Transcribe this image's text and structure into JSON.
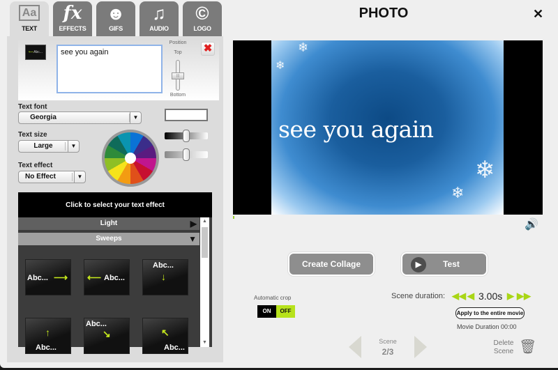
{
  "tabs": [
    {
      "label": "TEXT",
      "icon": "Aa",
      "active": true
    },
    {
      "label": "EFFECTS",
      "icon": "fx",
      "active": false
    },
    {
      "label": "GIFS",
      "icon": "☻",
      "active": false
    },
    {
      "label": "AUDIO",
      "icon": "♫",
      "active": false
    },
    {
      "label": "LOGO",
      "icon": "©",
      "active": false
    }
  ],
  "text_editor": {
    "thumb_label": "Abc...",
    "text_value": "see you again",
    "position_label": "Position",
    "position_top": "Top",
    "position_bottom": "Bottom",
    "delete_icon": "✖"
  },
  "text_font": {
    "label": "Text font",
    "value": "Georgia"
  },
  "text_size": {
    "label": "Text size",
    "value": "Large"
  },
  "text_effect": {
    "label": "Text effect",
    "value": "No Effect"
  },
  "color": {
    "swatch": "#ffffff",
    "brightness": 0.5,
    "opacity": 0.5
  },
  "effects": {
    "header": "Click to select your text effect",
    "categories": [
      {
        "label": "Light",
        "expanded": false
      },
      {
        "label": "Sweeps",
        "expanded": true
      }
    ],
    "tiles": [
      {
        "text": "Abc...",
        "arrow": "⟶"
      },
      {
        "text": "Abc...",
        "arrow": "⟵"
      },
      {
        "text": "Abc...",
        "arrow": "↓"
      },
      {
        "text": "Abc...",
        "arrow": "↑"
      },
      {
        "text": "Abc...",
        "arrow": "↘"
      },
      {
        "text": "Abc...",
        "arrow": "↖"
      }
    ]
  },
  "header": {
    "title": "PHOTO",
    "close": "✕"
  },
  "preview": {
    "slide_text": "see you again"
  },
  "buttons": {
    "create_collage": "Create Collage",
    "test": "Test"
  },
  "auto_crop": {
    "label": "Automatic crop",
    "on": "ON",
    "off": "OFF"
  },
  "duration": {
    "label": "Scene duration:",
    "value": "3.00s",
    "apply": "Apply to the entire movie",
    "movie_duration": "Movie Duration 00:00"
  },
  "scene": {
    "label": "Scene",
    "value": "2/3"
  },
  "delete_scene": {
    "line1": "Delete",
    "line2": "Scene"
  }
}
